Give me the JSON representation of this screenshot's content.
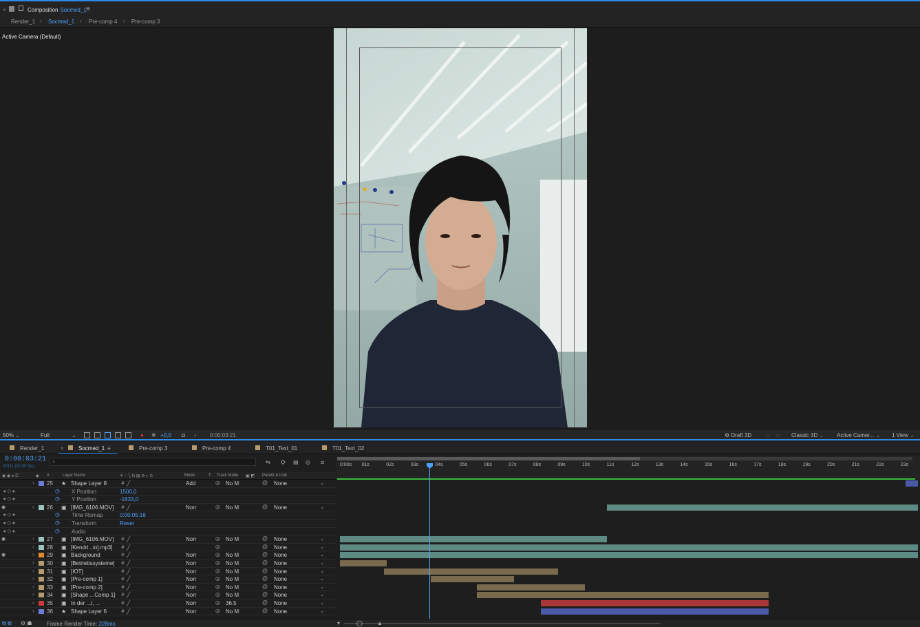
{
  "top": {
    "close": "×",
    "title": "Composition",
    "comp": "Socmed_1",
    "menu": "≡"
  },
  "breadcrumbs": [
    "Render_1",
    "Socmed_1",
    "Pre-comp 4",
    "Pre-comp 3"
  ],
  "viewer": {
    "camera_label": "Active Camera (Default)"
  },
  "viewer_bar": {
    "zoom": "50%",
    "resolution": "Full",
    "exposure": "+0,0",
    "timecode": "0:00:03:21",
    "renderer": "Draft 3D",
    "renderer_mode": "Classic 3D",
    "view": "Active Camer...",
    "layout": "1 View"
  },
  "tabs": [
    {
      "label": "Render_1",
      "color": "#b59b6e"
    },
    {
      "label": "Socmed_1",
      "color": "#b59b6e"
    },
    {
      "label": "Pre-comp 3",
      "color": "#b59b6e"
    },
    {
      "label": "Pre-comp 4",
      "color": "#b59b6e"
    },
    {
      "label": "T01_Text_01",
      "color": "#b59b6e"
    },
    {
      "label": "T01_Text_02",
      "color": "#b59b6e"
    }
  ],
  "timeline": {
    "timecode": "0:00:03:21",
    "fps": "00111 (30.00 fps)",
    "search_placeholder": "",
    "headers": {
      "layer_name": "Layer Name",
      "mode": "Mode",
      "t": "T",
      "track_matte": "Track Matte",
      "parent": "Parent & Link",
      "num": "#"
    },
    "ruler": [
      "0:00s",
      "01s",
      "02s",
      "03s",
      "04s",
      "05s",
      "06s",
      "07s",
      "08s",
      "09s",
      "10s",
      "11s",
      "12s",
      "13s",
      "14s",
      "15s",
      "16s",
      "17s",
      "18s",
      "19s",
      "20s",
      "21s",
      "22s",
      "23s"
    ],
    "rows": [
      {
        "num": "25",
        "name": "Shape Layer 8",
        "color": "#6b7bd6",
        "mode": "Add",
        "tm": "No M",
        "parent": "None",
        "star": "★"
      },
      {
        "sub": true,
        "name": "X Position",
        "value": "1500,0"
      },
      {
        "sub": true,
        "name": "Y Position",
        "value": "-1633,0"
      },
      {
        "num": "26",
        "name": "[IMG_6106.MOV]",
        "color": "#9ac3bc",
        "mode": "Norr",
        "tm": "No M",
        "parent": "None"
      },
      {
        "sub": true,
        "name": "Time Remap",
        "value": "0:00:05:16"
      },
      {
        "sub": true,
        "name": "Transform",
        "value": "Reset"
      },
      {
        "sub": true,
        "name": "Audio",
        "value": ""
      },
      {
        "num": "27",
        "name": "[IMG_6106.MOV]",
        "color": "#9ac3bc",
        "mode": "Norr",
        "tm": "No M",
        "parent": "None"
      },
      {
        "num": "28",
        "name": "[Kendri...io].mp3]",
        "color": "#9ac3bc",
        "mode": "",
        "tm": "",
        "parent": "None"
      },
      {
        "num": "29",
        "name": "Background",
        "color": "#e08b2b",
        "mode": "Norr",
        "tm": "No M",
        "parent": "None"
      },
      {
        "num": "30",
        "name": "[Betriebssysteme]",
        "color": "#b59b6e",
        "mode": "Norr",
        "tm": "No M",
        "parent": "None"
      },
      {
        "num": "31",
        "name": "[IOT]",
        "color": "#b59b6e",
        "mode": "Norr",
        "tm": "No M",
        "parent": "None"
      },
      {
        "num": "32",
        "name": "[Pre-comp 1]",
        "color": "#b59b6e",
        "mode": "Norr",
        "tm": "No M",
        "parent": "None"
      },
      {
        "num": "33",
        "name": "[Pre-comp 2]",
        "color": "#b59b6e",
        "mode": "Norr",
        "tm": "No M",
        "parent": "None"
      },
      {
        "num": "34",
        "name": "[Shape ...Comp 1]",
        "color": "#b59b6e",
        "mode": "Norr",
        "tm": "No M",
        "parent": "None"
      },
      {
        "num": "35",
        "name": "In der ...l, ... ·",
        "color": "#d03a3a",
        "mode": "Norr",
        "tm": "36.5",
        "parent": "None"
      },
      {
        "num": "36",
        "name": "Shape Layer 6",
        "color": "#6b7bd6",
        "mode": "Norr",
        "tm": "No M",
        "parent": "None",
        "star": "★"
      }
    ],
    "status": {
      "label": "Frame Render Time:",
      "value": "228ms"
    }
  },
  "colors": {
    "accent": "#2d8ceb",
    "bar_teal": "#5e8a84",
    "bar_tan": "#7a6a4e",
    "bar_red": "#a93636",
    "bar_blue": "#4b5aa8",
    "bar_green": "#3dbb3d"
  }
}
